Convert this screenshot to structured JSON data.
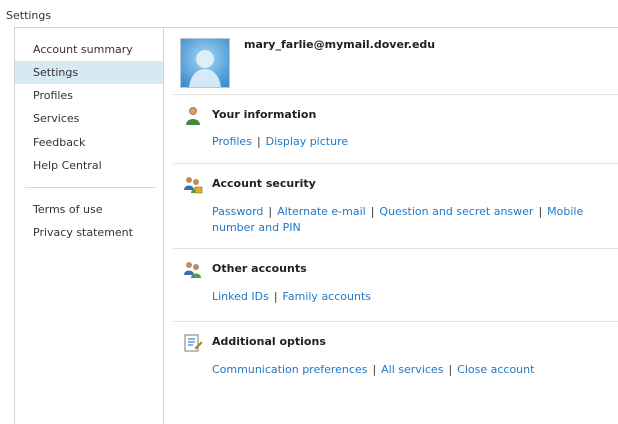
{
  "page": {
    "title": "Settings"
  },
  "sidebar": {
    "items": [
      {
        "label": "Account summary"
      },
      {
        "label": "Settings"
      },
      {
        "label": "Profiles"
      },
      {
        "label": "Services"
      },
      {
        "label": "Feedback"
      },
      {
        "label": "Help Central"
      },
      {
        "label": "Terms of use"
      },
      {
        "label": "Privacy statement"
      }
    ],
    "selected": "Settings",
    "selected_color": "#d7e9f2"
  },
  "main": {
    "email": "mary_farlie@mymail.dover.edu",
    "link_color": "#1f78c8",
    "sections": [
      {
        "title": "Your information",
        "icon": "person-icon",
        "links": [
          "Profiles",
          "Display picture"
        ]
      },
      {
        "title": "Account security",
        "icon": "users-lock-icon",
        "links": [
          "Password",
          "Alternate e-mail",
          "Question and secret answer",
          "Mobile number and PIN"
        ]
      },
      {
        "title": "Other accounts",
        "icon": "users-icon",
        "links": [
          "Linked IDs",
          "Family accounts"
        ]
      },
      {
        "title": "Additional options",
        "icon": "options-list-icon",
        "links": [
          "Communication preferences",
          "All services",
          "Close account"
        ]
      }
    ]
  }
}
